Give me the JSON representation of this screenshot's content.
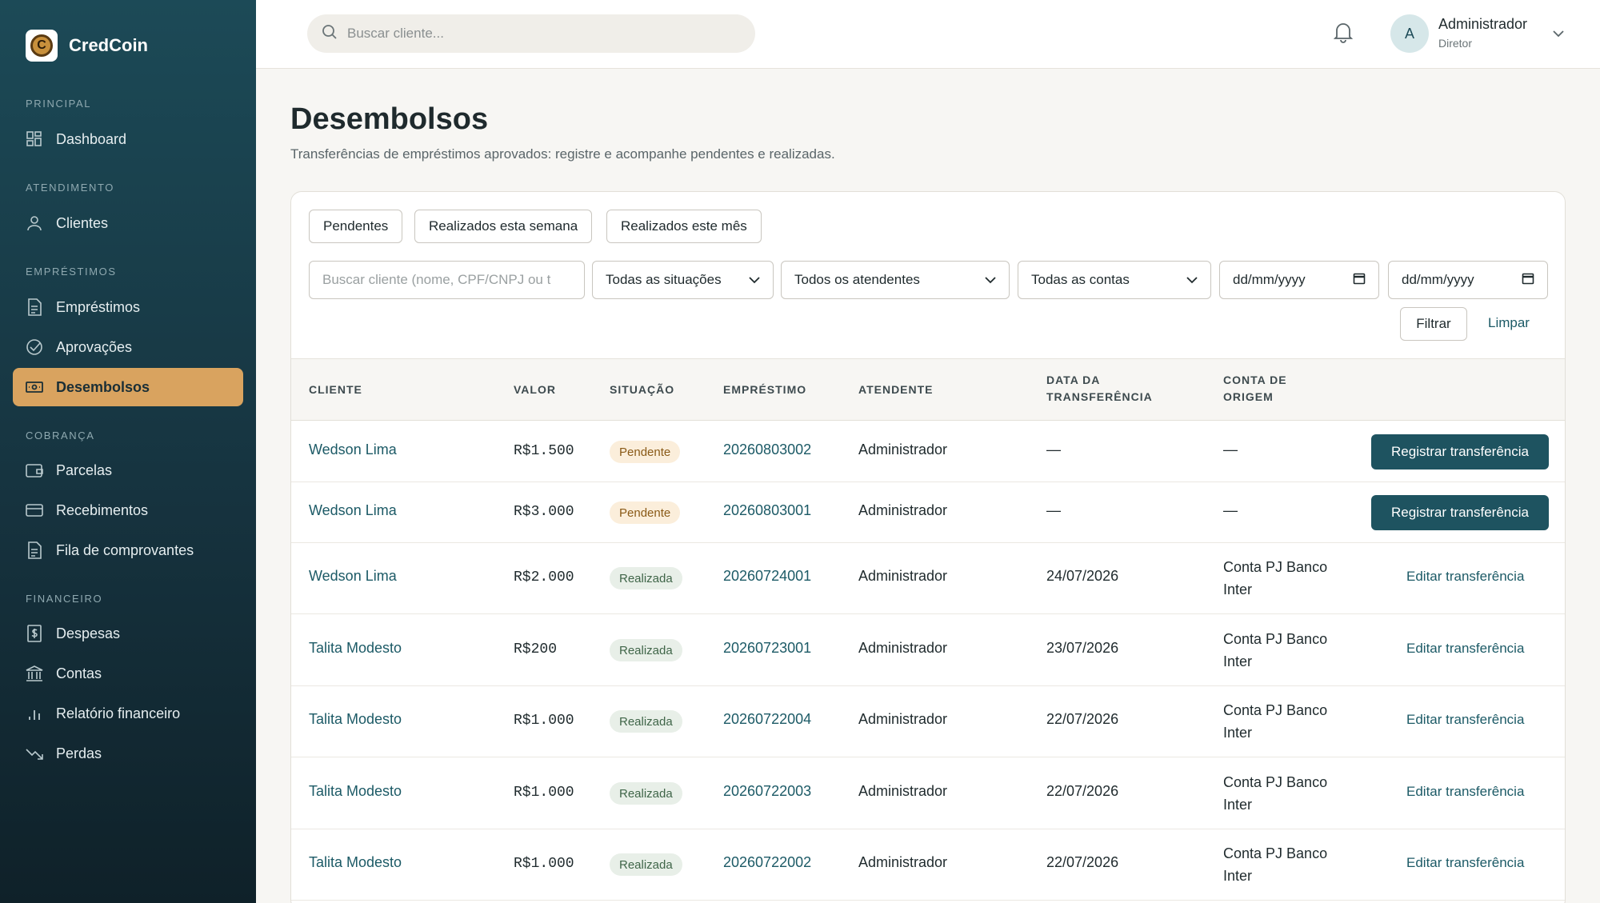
{
  "brand": {
    "name": "CredCoin",
    "logo_letter": "C"
  },
  "sidebar": {
    "sections": [
      {
        "title": "PRINCIPAL",
        "items": [
          {
            "label": "Dashboard",
            "icon": "grid-icon"
          }
        ]
      },
      {
        "title": "ATENDIMENTO",
        "items": [
          {
            "label": "Clientes",
            "icon": "user-icon"
          }
        ]
      },
      {
        "title": "EMPRÉSTIMOS",
        "items": [
          {
            "label": "Empréstimos",
            "icon": "document-icon"
          },
          {
            "label": "Aprovações",
            "icon": "check-circle-icon"
          },
          {
            "label": "Desembolsos",
            "icon": "money-icon",
            "active": true
          }
        ]
      },
      {
        "title": "COBRANÇA",
        "items": [
          {
            "label": "Parcelas",
            "icon": "wallet-icon"
          },
          {
            "label": "Recebimentos",
            "icon": "card-icon"
          },
          {
            "label": "Fila de comprovantes",
            "icon": "receipt-icon"
          }
        ]
      },
      {
        "title": "FINANCEIRO",
        "items": [
          {
            "label": "Despesas",
            "icon": "dollar-doc-icon"
          },
          {
            "label": "Contas",
            "icon": "bank-icon"
          },
          {
            "label": "Relatório financeiro",
            "icon": "bar-chart-icon"
          },
          {
            "label": "Perdas",
            "icon": "trending-down-icon"
          }
        ]
      }
    ]
  },
  "header": {
    "search_placeholder": "Buscar cliente...",
    "user": {
      "initial": "A",
      "name": "Administrador",
      "role": "Diretor"
    }
  },
  "page": {
    "title": "Desembolsos",
    "subtitle": "Transferências de empréstimos aprovados: registre e acompanhe pendentes e realizadas."
  },
  "quick_filters": [
    "Pendentes",
    "Realizados esta semana",
    "Realizados este mês"
  ],
  "filters": {
    "search_placeholder": "Buscar cliente (nome, CPF/CNPJ ou t",
    "status": "Todas as situações",
    "attendant": "Todos os atendentes",
    "account": "Todas as contas",
    "date_from": "dd/mm/yyyy",
    "date_to": "dd/mm/yyyy",
    "filter_label": "Filtrar",
    "clear_label": "Limpar"
  },
  "table": {
    "columns": {
      "client": "CLIENTE",
      "value": "VALOR",
      "status": "SITUAÇÃO",
      "loan": "EMPRÉSTIMO",
      "attendant": "ATENDENTE",
      "date_1": "DATA DA",
      "date_2": "TRANSFERÊNCIA",
      "account_1": "CONTA DE",
      "account_2": "ORIGEM"
    },
    "rows": [
      {
        "client": "Wedson Lima",
        "value": "R$1.500",
        "status": "Pendente",
        "loan": "20260803002",
        "attendant": "Administrador",
        "date": "—",
        "account_1": "—",
        "account_2": "",
        "action": "Registrar transferência"
      },
      {
        "client": "Wedson Lima",
        "value": "R$3.000",
        "status": "Pendente",
        "loan": "20260803001",
        "attendant": "Administrador",
        "date": "—",
        "account_1": "—",
        "account_2": "",
        "action": "Registrar transferência"
      },
      {
        "client": "Wedson Lima",
        "value": "R$2.000",
        "status": "Realizada",
        "loan": "20260724001",
        "attendant": "Administrador",
        "date": "24/07/2026",
        "account_1": "Conta PJ Banco",
        "account_2": "Inter",
        "action": "Editar transferência"
      },
      {
        "client": "Talita Modesto",
        "value": "R$200",
        "status": "Realizada",
        "loan": "20260723001",
        "attendant": "Administrador",
        "date": "23/07/2026",
        "account_1": "Conta PJ Banco",
        "account_2": "Inter",
        "action": "Editar transferência"
      },
      {
        "client": "Talita Modesto",
        "value": "R$1.000",
        "status": "Realizada",
        "loan": "20260722004",
        "attendant": "Administrador",
        "date": "22/07/2026",
        "account_1": "Conta PJ Banco",
        "account_2": "Inter",
        "action": "Editar transferência"
      },
      {
        "client": "Talita Modesto",
        "value": "R$1.000",
        "status": "Realizada",
        "loan": "20260722003",
        "attendant": "Administrador",
        "date": "22/07/2026",
        "account_1": "Conta PJ Banco",
        "account_2": "Inter",
        "action": "Editar transferência"
      },
      {
        "client": "Talita Modesto",
        "value": "R$1.000",
        "status": "Realizada",
        "loan": "20260722002",
        "attendant": "Administrador",
        "date": "22/07/2026",
        "account_1": "Conta PJ Banco",
        "account_2": "Inter",
        "action": "Editar transferência"
      }
    ]
  },
  "colors": {
    "sidebar": "#1c4a57",
    "accent": "#d9a35f",
    "primary_button": "#1e5360",
    "link": "#1c5a66"
  }
}
